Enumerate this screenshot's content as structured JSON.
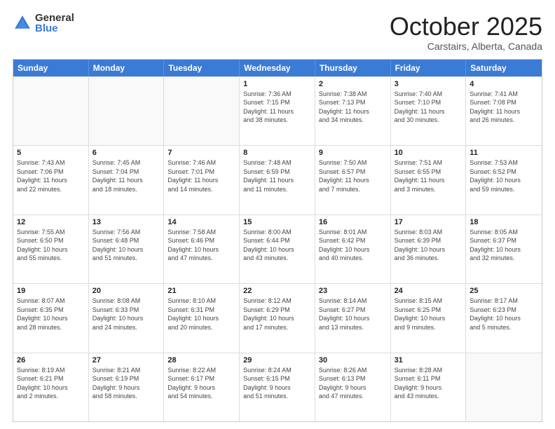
{
  "logo": {
    "general": "General",
    "blue": "Blue"
  },
  "title": "October 2025",
  "location": "Carstairs, Alberta, Canada",
  "days": [
    "Sunday",
    "Monday",
    "Tuesday",
    "Wednesday",
    "Thursday",
    "Friday",
    "Saturday"
  ],
  "rows": [
    [
      {
        "day": "",
        "text": "",
        "empty": true
      },
      {
        "day": "",
        "text": "",
        "empty": true
      },
      {
        "day": "",
        "text": "",
        "empty": true
      },
      {
        "day": "1",
        "text": "Sunrise: 7:36 AM\nSunset: 7:15 PM\nDaylight: 11 hours\nand 38 minutes."
      },
      {
        "day": "2",
        "text": "Sunrise: 7:38 AM\nSunset: 7:13 PM\nDaylight: 11 hours\nand 34 minutes."
      },
      {
        "day": "3",
        "text": "Sunrise: 7:40 AM\nSunset: 7:10 PM\nDaylight: 11 hours\nand 30 minutes."
      },
      {
        "day": "4",
        "text": "Sunrise: 7:41 AM\nSunset: 7:08 PM\nDaylight: 11 hours\nand 26 minutes."
      }
    ],
    [
      {
        "day": "5",
        "text": "Sunrise: 7:43 AM\nSunset: 7:06 PM\nDaylight: 11 hours\nand 22 minutes."
      },
      {
        "day": "6",
        "text": "Sunrise: 7:45 AM\nSunset: 7:04 PM\nDaylight: 11 hours\nand 18 minutes."
      },
      {
        "day": "7",
        "text": "Sunrise: 7:46 AM\nSunset: 7:01 PM\nDaylight: 11 hours\nand 14 minutes."
      },
      {
        "day": "8",
        "text": "Sunrise: 7:48 AM\nSunset: 6:59 PM\nDaylight: 11 hours\nand 11 minutes."
      },
      {
        "day": "9",
        "text": "Sunrise: 7:50 AM\nSunset: 6:57 PM\nDaylight: 11 hours\nand 7 minutes."
      },
      {
        "day": "10",
        "text": "Sunrise: 7:51 AM\nSunset: 6:55 PM\nDaylight: 11 hours\nand 3 minutes."
      },
      {
        "day": "11",
        "text": "Sunrise: 7:53 AM\nSunset: 6:52 PM\nDaylight: 10 hours\nand 59 minutes."
      }
    ],
    [
      {
        "day": "12",
        "text": "Sunrise: 7:55 AM\nSunset: 6:50 PM\nDaylight: 10 hours\nand 55 minutes."
      },
      {
        "day": "13",
        "text": "Sunrise: 7:56 AM\nSunset: 6:48 PM\nDaylight: 10 hours\nand 51 minutes."
      },
      {
        "day": "14",
        "text": "Sunrise: 7:58 AM\nSunset: 6:46 PM\nDaylight: 10 hours\nand 47 minutes."
      },
      {
        "day": "15",
        "text": "Sunrise: 8:00 AM\nSunset: 6:44 PM\nDaylight: 10 hours\nand 43 minutes."
      },
      {
        "day": "16",
        "text": "Sunrise: 8:01 AM\nSunset: 6:42 PM\nDaylight: 10 hours\nand 40 minutes."
      },
      {
        "day": "17",
        "text": "Sunrise: 8:03 AM\nSunset: 6:39 PM\nDaylight: 10 hours\nand 36 minutes."
      },
      {
        "day": "18",
        "text": "Sunrise: 8:05 AM\nSunset: 6:37 PM\nDaylight: 10 hours\nand 32 minutes."
      }
    ],
    [
      {
        "day": "19",
        "text": "Sunrise: 8:07 AM\nSunset: 6:35 PM\nDaylight: 10 hours\nand 28 minutes."
      },
      {
        "day": "20",
        "text": "Sunrise: 8:08 AM\nSunset: 6:33 PM\nDaylight: 10 hours\nand 24 minutes."
      },
      {
        "day": "21",
        "text": "Sunrise: 8:10 AM\nSunset: 6:31 PM\nDaylight: 10 hours\nand 20 minutes."
      },
      {
        "day": "22",
        "text": "Sunrise: 8:12 AM\nSunset: 6:29 PM\nDaylight: 10 hours\nand 17 minutes."
      },
      {
        "day": "23",
        "text": "Sunrise: 8:14 AM\nSunset: 6:27 PM\nDaylight: 10 hours\nand 13 minutes."
      },
      {
        "day": "24",
        "text": "Sunrise: 8:15 AM\nSunset: 6:25 PM\nDaylight: 10 hours\nand 9 minutes."
      },
      {
        "day": "25",
        "text": "Sunrise: 8:17 AM\nSunset: 6:23 PM\nDaylight: 10 hours\nand 5 minutes."
      }
    ],
    [
      {
        "day": "26",
        "text": "Sunrise: 8:19 AM\nSunset: 6:21 PM\nDaylight: 10 hours\nand 2 minutes."
      },
      {
        "day": "27",
        "text": "Sunrise: 8:21 AM\nSunset: 6:19 PM\nDaylight: 9 hours\nand 58 minutes."
      },
      {
        "day": "28",
        "text": "Sunrise: 8:22 AM\nSunset: 6:17 PM\nDaylight: 9 hours\nand 54 minutes."
      },
      {
        "day": "29",
        "text": "Sunrise: 8:24 AM\nSunset: 6:15 PM\nDaylight: 9 hours\nand 51 minutes."
      },
      {
        "day": "30",
        "text": "Sunrise: 8:26 AM\nSunset: 6:13 PM\nDaylight: 9 hours\nand 47 minutes."
      },
      {
        "day": "31",
        "text": "Sunrise: 8:28 AM\nSunset: 6:11 PM\nDaylight: 9 hours\nand 43 minutes."
      },
      {
        "day": "",
        "text": "",
        "empty": true
      }
    ]
  ]
}
